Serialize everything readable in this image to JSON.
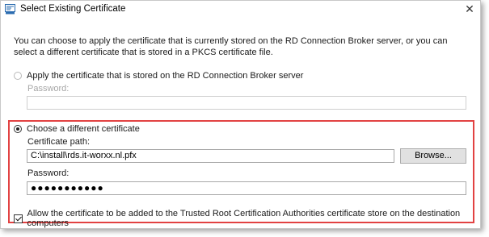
{
  "window": {
    "title": "Select Existing Certificate",
    "close_glyph": "✕"
  },
  "intro_text": "You can choose to apply the certificate that is currently stored on the RD Connection Broker server, or you can select a different certificate that is stored in a PKCS certificate file.",
  "option_broker": {
    "label": "Apply the certificate that is stored on the RD Connection Broker server",
    "selected": false,
    "password_label": "Password:",
    "password_value": ""
  },
  "option_file": {
    "label": "Choose a different certificate",
    "selected": true,
    "path_label": "Certificate path:",
    "path_value": "C:\\install\\rds.it-worxx.nl.pfx",
    "browse_label": "Browse...",
    "password_label": "Password:",
    "password_value": "●●●●●●●●●●●"
  },
  "trust_checkbox": {
    "label": "Allow the certificate to be added to the Trusted Root Certification Authorities certificate store on the destination computers",
    "checked": true
  },
  "colors": {
    "highlight": "#e24242",
    "icon_blue": "#2b6cb0"
  }
}
